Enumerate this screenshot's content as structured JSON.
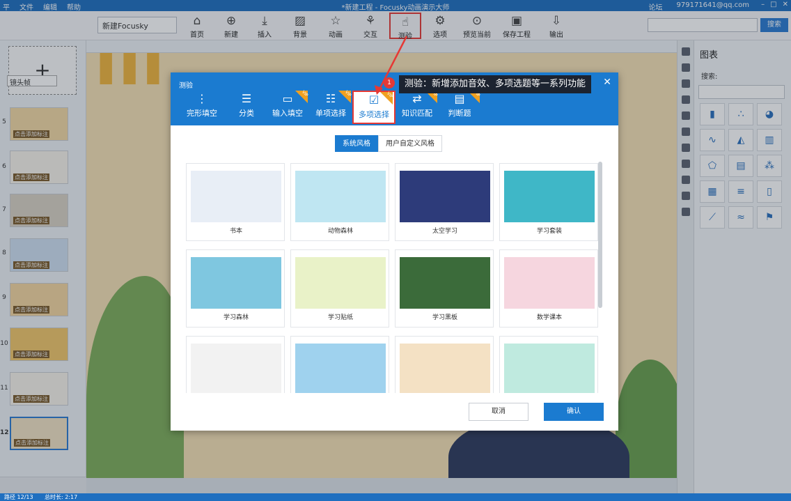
{
  "titlebar": {
    "menu": [
      "平",
      "文件",
      "编辑",
      "帮助"
    ],
    "title": "*新建工程 - Focusky动画演示大师",
    "forum": "论坛",
    "account": "979171641@qq.com"
  },
  "toolbar": {
    "project_name": "新建Focusky",
    "buttons": [
      {
        "label": "首页",
        "icon": "home-icon"
      },
      {
        "label": "新建",
        "icon": "new-icon"
      },
      {
        "label": "插入",
        "icon": "insert-icon"
      },
      {
        "label": "背景",
        "icon": "background-icon"
      },
      {
        "label": "动画",
        "icon": "animation-icon"
      },
      {
        "label": "交互",
        "icon": "interaction-icon"
      },
      {
        "label": "测验",
        "icon": "quiz-icon"
      },
      {
        "label": "选项",
        "icon": "options-icon"
      },
      {
        "label": "预览当前",
        "icon": "preview-icon"
      },
      {
        "label": "保存工程",
        "icon": "save-icon"
      },
      {
        "label": "输出",
        "icon": "export-icon"
      }
    ],
    "search_button": "搜索"
  },
  "left_panel": {
    "frame_type": "镜头帧",
    "slides": [
      {
        "num": "5",
        "caption": "点击添加标注"
      },
      {
        "num": "6",
        "caption": "点击添加标注"
      },
      {
        "num": "7",
        "caption": "点击添加标注"
      },
      {
        "num": "8",
        "caption": "点击添加标注"
      },
      {
        "num": "9",
        "caption": "点击添加标注"
      },
      {
        "num": "10",
        "caption": "点击添加标注"
      },
      {
        "num": "11",
        "caption": "点击添加标注"
      },
      {
        "num": "12",
        "caption": "点击添加标注"
      }
    ]
  },
  "right_panel": {
    "title": "图表",
    "search_label": "搜索:"
  },
  "statusbar": {
    "path": "路径 12/13",
    "duration": "总时长: 2:17"
  },
  "dialog": {
    "title": "测验",
    "badge": "1",
    "tooltip": "测验：新增添加音效、多项选题等一系列功能",
    "tabs": [
      {
        "label": "完形填空",
        "vip": false
      },
      {
        "label": "分类",
        "vip": false
      },
      {
        "label": "输入填空",
        "vip": true
      },
      {
        "label": "单项选择",
        "vip": true
      },
      {
        "label": "多项选择",
        "vip": true,
        "active": true
      },
      {
        "label": "知识匹配",
        "vip": true
      },
      {
        "label": "判断题",
        "vip": true
      }
    ],
    "vip_text": "VIP",
    "style_tabs": [
      "系统风格",
      "用户自定义风格"
    ],
    "templates": [
      {
        "name": "书本",
        "color": "#e8eef6"
      },
      {
        "name": "动物森林",
        "color": "#bfe6f2"
      },
      {
        "name": "太空学习",
        "color": "#2d3b7a"
      },
      {
        "name": "学习套装",
        "color": "#3fb7c7"
      },
      {
        "name": "学习森林",
        "color": "#7fc7e0"
      },
      {
        "name": "学习贴纸",
        "color": "#e9f2c8"
      },
      {
        "name": "学习黑板",
        "color": "#3b6b3a"
      },
      {
        "name": "数学课本",
        "color": "#f6d6df"
      },
      {
        "name": "",
        "color": "#f2f2f2"
      },
      {
        "name": "",
        "color": "#9fd2ee"
      },
      {
        "name": "",
        "color": "#f4e1c4"
      },
      {
        "name": "",
        "color": "#bfeadf"
      }
    ],
    "cancel": "取消",
    "confirm": "确认"
  },
  "colors": {
    "brand_blue": "#1b7bd0",
    "highlight_red": "#e53935",
    "vip_orange": "#f0a020"
  }
}
